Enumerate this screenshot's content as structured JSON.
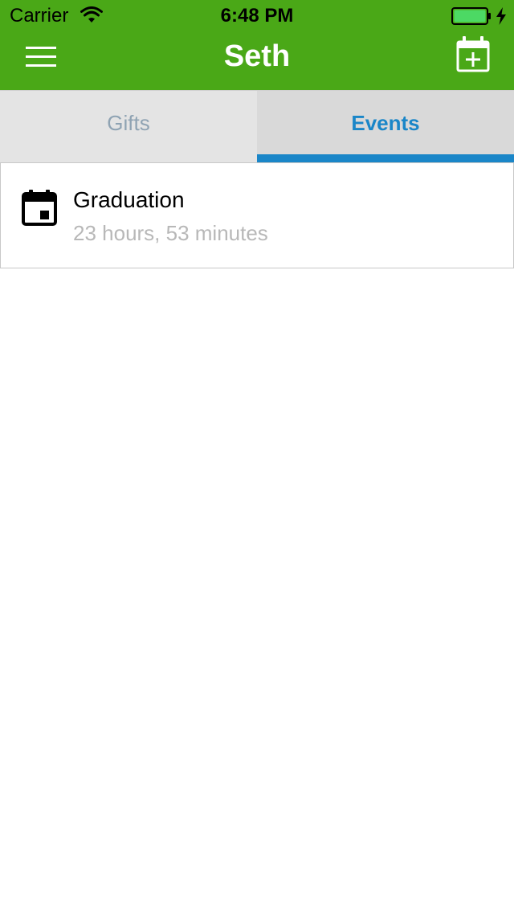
{
  "status_bar": {
    "carrier": "Carrier",
    "time": "6:48 PM",
    "battery_color": "#4cd964"
  },
  "header": {
    "title": "Seth",
    "color": "#4aa817",
    "menu_icon": "hamburger-menu-icon",
    "add_icon": "calendar-add-icon"
  },
  "tabs": [
    {
      "label": "Gifts",
      "selected": false
    },
    {
      "label": "Events",
      "selected": true
    }
  ],
  "tab_colors": {
    "active": "#1a86c8",
    "inactive": "#8fa3b3"
  },
  "events": [
    {
      "name": "Graduation",
      "countdown": "23 hours, 53 minutes",
      "icon": "calendar-event-icon"
    }
  ]
}
